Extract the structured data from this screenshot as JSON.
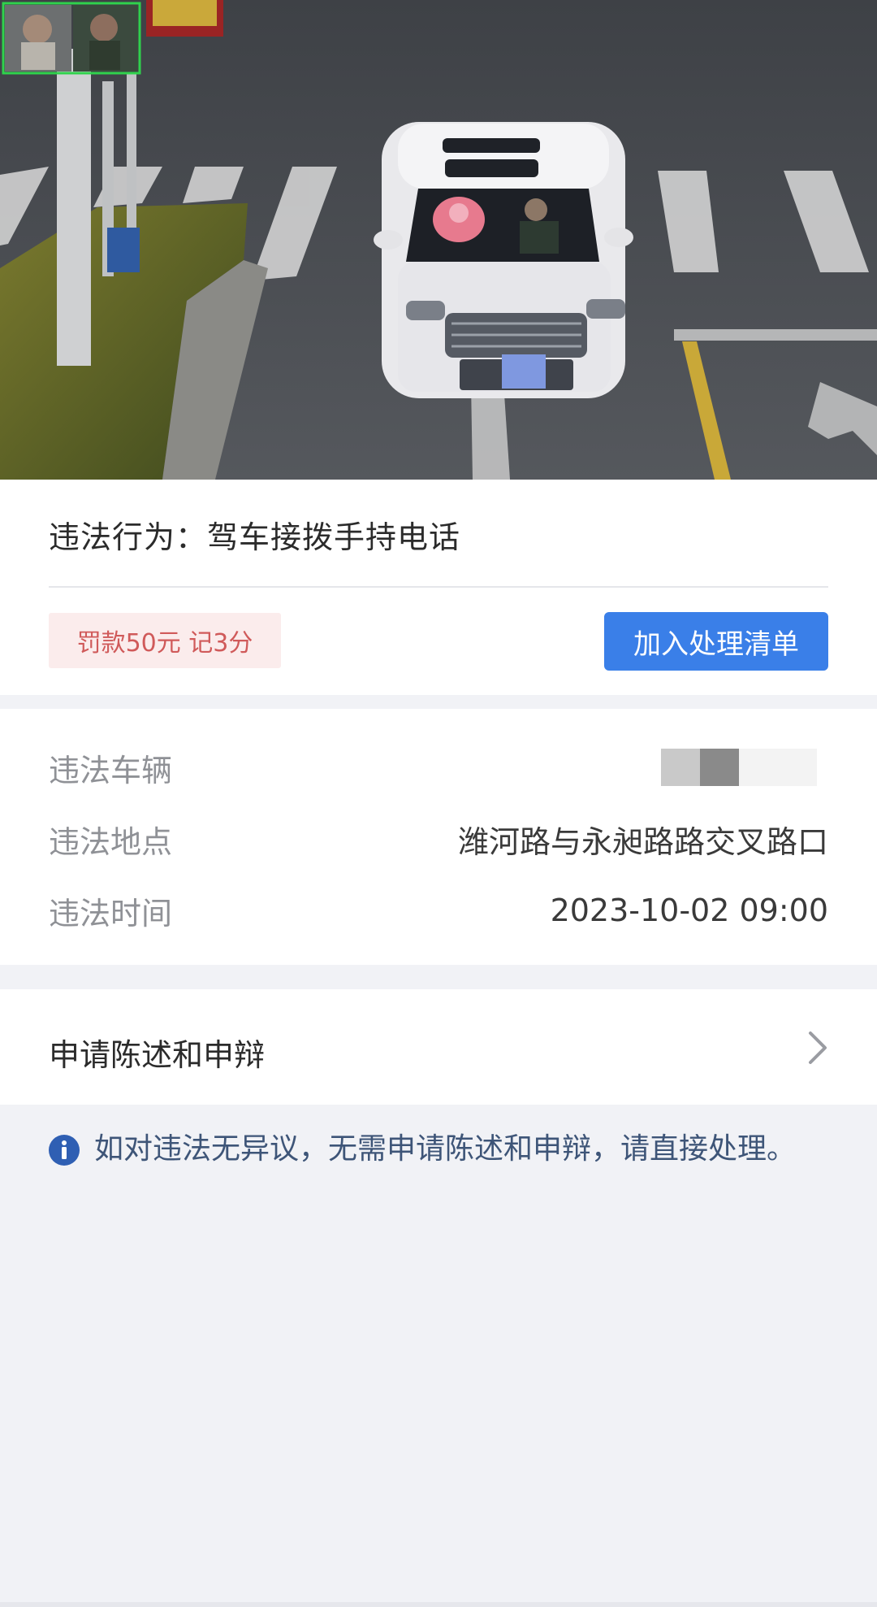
{
  "violation": {
    "title": "违法行为：驾车接拨手持电话",
    "fine_badge": "罚款50元 记3分",
    "add_button_label": "加入处理清单"
  },
  "details": {
    "vehicle_label": "违法车辆",
    "location_label": "违法地点",
    "location_value": "潍河路与永昶路路交叉路口",
    "time_label": "违法时间",
    "time_value": "2023-10-02 09:00"
  },
  "appeal": {
    "label": "申请陈述和申辩"
  },
  "notice": {
    "text": "如对违法无异议，无需申请陈述和申辩，请直接处理。"
  },
  "colors": {
    "primary_button": "#3a7fe8",
    "fine_badge_bg": "#fbecec",
    "fine_badge_text": "#d05a5a",
    "page_bg": "#f1f2f6",
    "notice_text": "#3e5578"
  },
  "icons": {
    "appeal_arrow": "chevron-right-icon",
    "notice": "info-icon"
  }
}
